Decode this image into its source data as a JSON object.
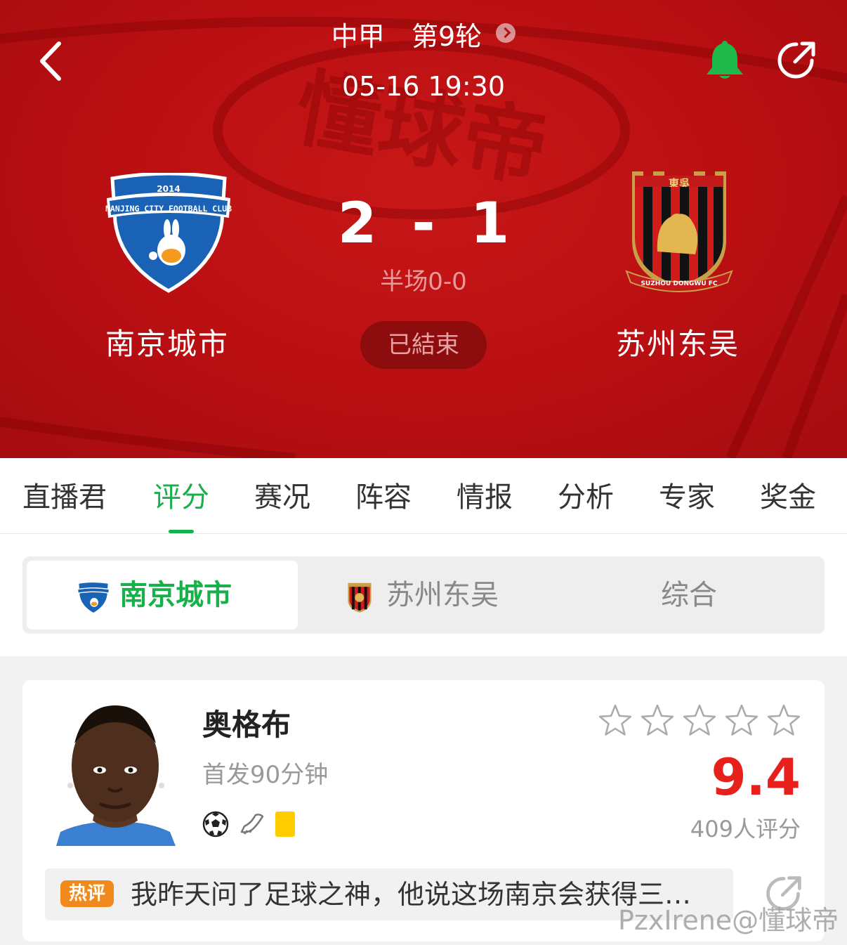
{
  "header": {
    "league": "中甲",
    "round": "第9轮",
    "datetime": "05-16 19:30",
    "watermark": "懂球帝",
    "home_team": {
      "name": "南京城市",
      "logo_text_top": "2014",
      "logo_text_main": "NANJING CITY FOOTBALL CLUB"
    },
    "away_team": {
      "name": "苏州东吴",
      "logo_text_top": "東吳",
      "logo_text_main": "SUZHOU DONGWU FC"
    },
    "home_score": "2",
    "score_separator": "-",
    "away_score": "1",
    "halftime": "半场0-0",
    "status": "已結束"
  },
  "tabs": [
    {
      "label": "直播君",
      "active": false
    },
    {
      "label": "评分",
      "active": true
    },
    {
      "label": "赛况",
      "active": false
    },
    {
      "label": "阵容",
      "active": false
    },
    {
      "label": "情报",
      "active": false
    },
    {
      "label": "分析",
      "active": false
    },
    {
      "label": "专家",
      "active": false
    },
    {
      "label": "奖金",
      "active": false
    }
  ],
  "segments": [
    {
      "label": "南京城市",
      "icon": "nanjing-city-logo",
      "active": true
    },
    {
      "label": "苏州东吴",
      "icon": "suzhou-dongwu-logo",
      "active": false
    },
    {
      "label": "综合",
      "active": false
    }
  ],
  "player": {
    "name": "奥格布",
    "play_time": "首发90分钟",
    "events": [
      "football-icon",
      "boot-assist-icon",
      "yellow-card-icon"
    ],
    "user_stars": 0,
    "max_stars": 5,
    "rating": "9.4",
    "rating_count": "409人评分"
  },
  "hot_comment": {
    "tag": "热评",
    "text": "我昨天问了足球之神，他说这场南京会获得三…"
  },
  "credit": "PzxIrene@懂球帝",
  "colors": {
    "header_red": "#b90f12",
    "accent_green": "#18b04a",
    "rating_red": "#e8201c",
    "bell_green": "#1fb84a",
    "hot_tag_orange": "#f08a1c"
  }
}
